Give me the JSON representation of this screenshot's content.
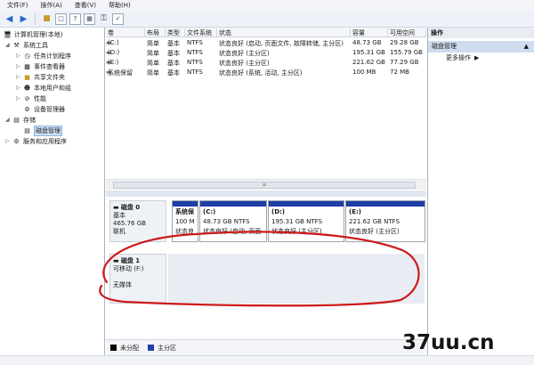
{
  "menu": [
    "文件(F)",
    "操作(A)",
    "查看(V)",
    "帮助(H)"
  ],
  "toolbar_icons": [
    "back-arrow-icon",
    "forward-arrow-icon",
    "folder-up-icon",
    "properties-icon",
    "help-icon",
    "properties2-icon",
    "key-icon",
    "check-icon"
  ],
  "tree": {
    "root": "计算机管理(本地)",
    "system_tools": "系统工具",
    "task_scheduler": "任务计划程序",
    "event_viewer": "事件查看器",
    "shared_folders": "共享文件夹",
    "local_users": "本地用户和组",
    "performance": "性能",
    "device_manager": "设备管理器",
    "storage": "存储",
    "disk_management": "磁盘管理",
    "services_apps": "服务和应用程序"
  },
  "volume_table": {
    "columns": [
      "卷",
      "布局",
      "类型",
      "文件系统",
      "状态",
      "容量",
      "可用空间"
    ],
    "rows": [
      {
        "vol": "(C:)",
        "layout": "简单",
        "type": "基本",
        "fs": "NTFS",
        "status": "状态良好 (启动, 页面文件, 故障转储, 主分区)",
        "capacity": "48.73 GB",
        "free": "29.28 GB"
      },
      {
        "vol": "(D:)",
        "layout": "简单",
        "type": "基本",
        "fs": "NTFS",
        "status": "状态良好 (主分区)",
        "capacity": "195.31 GB",
        "free": "155.79 GB"
      },
      {
        "vol": "(E:)",
        "layout": "简单",
        "type": "基本",
        "fs": "NTFS",
        "status": "状态良好 (主分区)",
        "capacity": "221.62 GB",
        "free": "77.29 GB"
      },
      {
        "vol": "系统保留",
        "layout": "简单",
        "type": "基本",
        "fs": "NTFS",
        "status": "状态良好 (系统, 活动, 主分区)",
        "capacity": "100 MB",
        "free": "72 MB"
      }
    ]
  },
  "disk0": {
    "name": "磁盘 0",
    "type": "基本",
    "size": "465.76 GB",
    "state": "联机",
    "partitions": [
      {
        "title": "系统保",
        "size": "100 M",
        "status": "状态良"
      },
      {
        "title": "(C:)",
        "size": "48.73 GB NTFS",
        "status": "状态良好 (启动, 页面"
      },
      {
        "title": "(D:)",
        "size": "195.31 GB NTFS",
        "status": "状态良好 (主分区)"
      },
      {
        "title": "(E:)",
        "size": "221.62 GB NTFS",
        "status": "状态良好 (主分区)"
      }
    ]
  },
  "disk1": {
    "name": "磁盘 1",
    "type": "可移动 (F:)",
    "media": "无媒体"
  },
  "legend": [
    {
      "label": "未分配",
      "color": "#000000"
    },
    {
      "label": "主分区",
      "color": "#1f3ea6"
    }
  ],
  "actions": {
    "header": "操作",
    "section": "磁盘管理",
    "more": "更多操作"
  },
  "watermark": "37uu.cn",
  "colors": {
    "partition_bar": "#1f3ea6",
    "annotation": "#cc1a1a",
    "selection": "#cfe2f8"
  }
}
